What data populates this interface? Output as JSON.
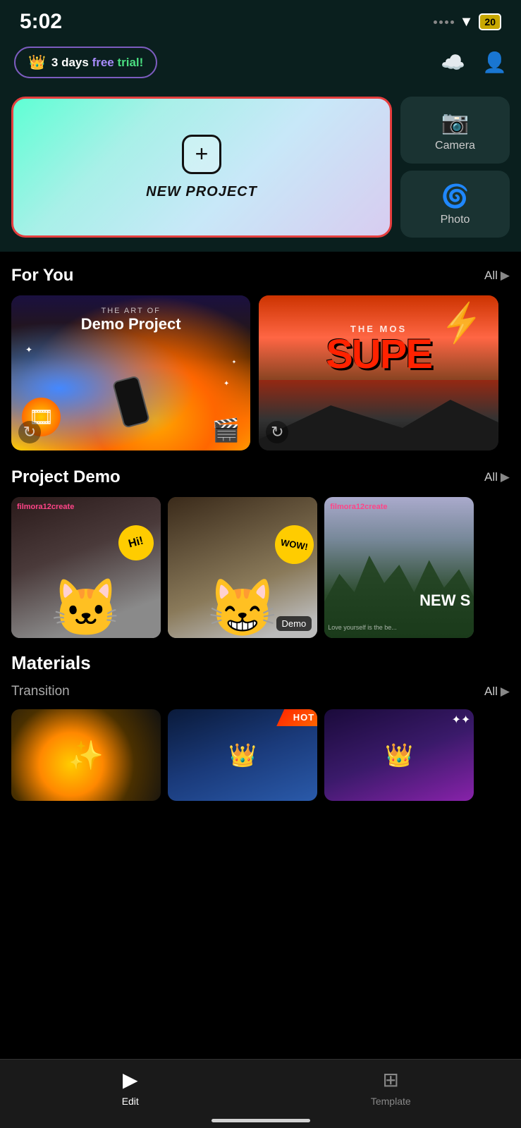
{
  "statusBar": {
    "time": "5:02",
    "battery": "20"
  },
  "header": {
    "trialBadge": {
      "prefix": "3 days ",
      "free": "free",
      "suffix": " trial!"
    },
    "cloudIcon": "cloud",
    "profileIcon": "person"
  },
  "newProject": {
    "label": "NEW PROJECT"
  },
  "sideButtons": [
    {
      "label": "Camera",
      "icon": "camera"
    },
    {
      "label": "Photo",
      "icon": "photo"
    }
  ],
  "forYou": {
    "title": "For You",
    "allLabel": "All",
    "cards": [
      {
        "topLabel": "THE ART OF",
        "mainLabel": "Demo Project"
      },
      {
        "topLabel": "THE MOS",
        "mainLabel": "SUPE"
      }
    ]
  },
  "projectDemo": {
    "title": "Project Demo",
    "allLabel": "All",
    "cards": [
      {
        "watermark": "filmora12create",
        "badge": ""
      },
      {
        "watermark": "",
        "badge": "Demo"
      },
      {
        "watermark": "filmora12create",
        "badge": ""
      }
    ]
  },
  "materials": {
    "title": "Materials",
    "transition": {
      "title": "Transition",
      "allLabel": "All",
      "hotLabel": "HOT"
    }
  },
  "tabBar": {
    "editLabel": "Edit",
    "templateLabel": "Template"
  }
}
